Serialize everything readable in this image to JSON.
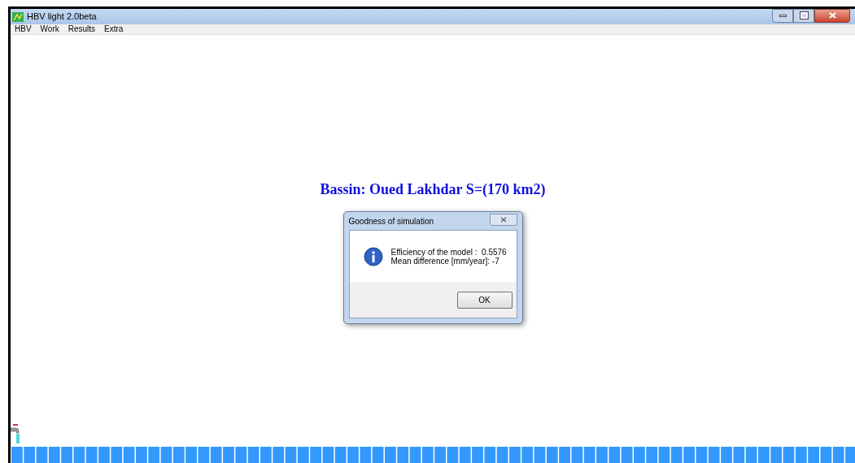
{
  "window": {
    "title": "HBV light 2.0beta"
  },
  "menu": [
    "HBV",
    "Work",
    "Results",
    "Extra"
  ],
  "heading": "Bassin: Oued Lakhdar S=(170 km2)",
  "dialog": {
    "title": "Goodness of simulation",
    "lines": [
      "Efficiency of the model :  0.5576",
      "Mean difference [mm/year]: -7"
    ],
    "button": "OK"
  }
}
